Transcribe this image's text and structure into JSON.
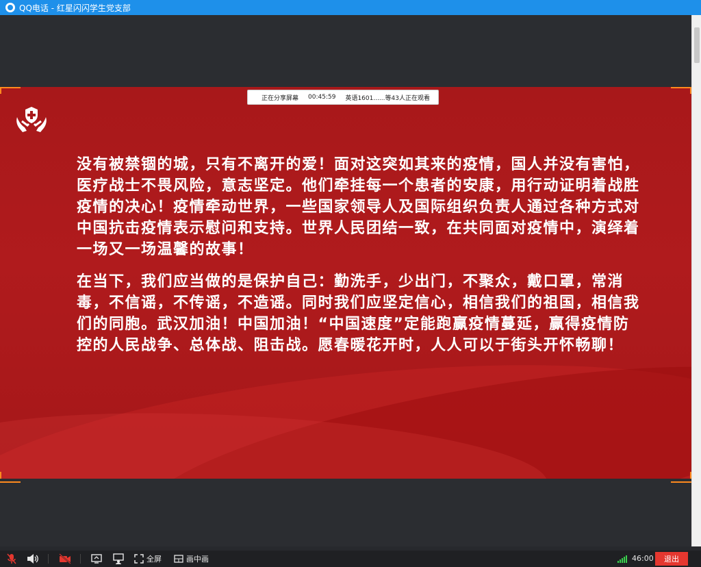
{
  "window": {
    "title": "QQ电话 - 红星闪闪学生党支部",
    "app_icon": "qq-icon"
  },
  "share_badge": {
    "status": "正在分享屏幕",
    "duration": "00:45:59",
    "viewers": "英语1601......等43人正在观看"
  },
  "slide": {
    "logo_icon": "hands-shield-icon",
    "paragraphs": [
      "没有被禁锢的城，只有不离开的爱！面对这突如其来的疫情，国人并没有害怕，医疗战士不畏风险，意志坚定。他们牵挂每一个患者的安康，用行动证明着战胜疫情的决心！疫情牵动世界，一些国家领导人及国际组织负责人通过各种方式对中国抗击疫情表示慰问和支持。世界人民团结一致，在共同面对疫情中，演绎着一场又一场温馨的故事！",
      "在当下，我们应当做的是保护自己：勤洗手，少出门，不聚众，戴口罩，常消毒，不信谣，不传谣，不造谣。同时我们应坚定信心，相信我们的祖国，相信我们的同胞。武汉加油！中国加油！“中国速度”定能跑赢疫情蔓延，赢得疫情防控的人民战争、总体战、阻击战。愿春暖花开时，人人可以于街头开怀畅聊！"
    ],
    "colors": {
      "background": "#a8181a",
      "corner_accent": "#ff8a1e",
      "text": "#ffffff"
    }
  },
  "toolbar": {
    "mic_icon": "mic-muted-icon",
    "speaker_icon": "speaker-icon",
    "camera_icon": "camera-off-icon",
    "screen_share_icon": "screen-share-icon",
    "whiteboard_icon": "presenter-icon",
    "fullscreen_label": "全屏",
    "pip_label": "画中画",
    "timer": "46:00",
    "exit_label": "退出",
    "exit_color": "#e5372f",
    "signal_color": "#3ad14d"
  }
}
